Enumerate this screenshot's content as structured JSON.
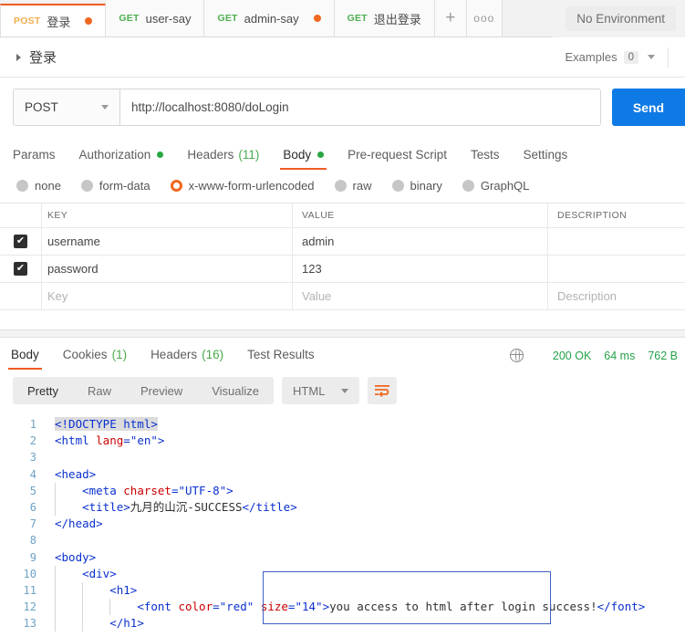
{
  "tabbar": {
    "tabs": [
      {
        "method": "POST",
        "name": "登录",
        "active": true,
        "unsaved": true
      },
      {
        "method": "GET",
        "name": "user-say",
        "active": false,
        "unsaved": false
      },
      {
        "method": "GET",
        "name": "admin-say",
        "active": false,
        "unsaved": true
      },
      {
        "method": "GET",
        "name": "退出登录",
        "active": false,
        "unsaved": false
      }
    ],
    "add_label": "+",
    "more_label": "●●●",
    "environment": "No Environment"
  },
  "request_header": {
    "title": "登录",
    "examples_label": "Examples",
    "examples_count": "0"
  },
  "url_row": {
    "method": "POST",
    "url": "http://localhost:8080/doLogin",
    "send_label": "Send"
  },
  "request_tabs": [
    {
      "label": "Params",
      "active": false,
      "dot": false,
      "count": ""
    },
    {
      "label": "Authorization",
      "active": false,
      "dot": true,
      "count": ""
    },
    {
      "label": "Headers",
      "active": false,
      "dot": false,
      "count": "(11)"
    },
    {
      "label": "Body",
      "active": true,
      "dot": true,
      "count": ""
    },
    {
      "label": "Pre-request Script",
      "active": false,
      "dot": false,
      "count": ""
    },
    {
      "label": "Tests",
      "active": false,
      "dot": false,
      "count": ""
    },
    {
      "label": "Settings",
      "active": false,
      "dot": false,
      "count": ""
    }
  ],
  "body_types": [
    {
      "label": "none",
      "selected": false
    },
    {
      "label": "form-data",
      "selected": false
    },
    {
      "label": "x-www-form-urlencoded",
      "selected": true
    },
    {
      "label": "raw",
      "selected": false
    },
    {
      "label": "binary",
      "selected": false
    },
    {
      "label": "GraphQL",
      "selected": false
    }
  ],
  "kv_table": {
    "headers": {
      "key": "KEY",
      "value": "VALUE",
      "description": "DESCRIPTION"
    },
    "rows": [
      {
        "checked": true,
        "key": "username",
        "value": "admin",
        "description": ""
      },
      {
        "checked": true,
        "key": "password",
        "value": "123",
        "description": ""
      }
    ],
    "placeholder_row": {
      "key": "Key",
      "value": "Value",
      "description": "Description"
    }
  },
  "response": {
    "tabs": [
      {
        "label": "Body",
        "active": true,
        "count": ""
      },
      {
        "label": "Cookies",
        "active": false,
        "count": "(1)"
      },
      {
        "label": "Headers",
        "active": false,
        "count": "(16)"
      },
      {
        "label": "Test Results",
        "active": false,
        "count": ""
      }
    ],
    "status": "200 OK",
    "time": "64 ms",
    "size": "762 B",
    "view_buttons": [
      {
        "label": "Pretty",
        "active": true
      },
      {
        "label": "Raw",
        "active": false
      },
      {
        "label": "Preview",
        "active": false
      },
      {
        "label": "Visualize",
        "active": false
      }
    ],
    "format": "HTML",
    "wrap_icon": "word-wrap-icon"
  },
  "code": {
    "lines": [
      {
        "n": "1",
        "html": "<span class=\"sel tag\">&lt;!DOCTYPE html&gt;</span>",
        "guides": 0
      },
      {
        "n": "2",
        "html": "<span class=\"tag\">&lt;html </span><span class=\"attr\">lang</span><span class=\"tag\">=</span><span class=\"str\">\"en\"</span><span class=\"tag\">&gt;</span>",
        "guides": 0
      },
      {
        "n": "3",
        "html": "",
        "guides": 0
      },
      {
        "n": "4",
        "html": "<span class=\"tag\">&lt;head&gt;</span>",
        "guides": 0
      },
      {
        "n": "5",
        "html": "    <span class=\"tag\">&lt;meta </span><span class=\"attr\">charset</span><span class=\"tag\">=</span><span class=\"str\">\"UTF-8\"</span><span class=\"tag\">&gt;</span>",
        "guides": 1
      },
      {
        "n": "6",
        "html": "    <span class=\"tag\">&lt;title&gt;</span><span class=\"txt\">九月的山沉-SUCCESS</span><span class=\"tag\">&lt;/title&gt;</span>",
        "guides": 1
      },
      {
        "n": "7",
        "html": "<span class=\"tag\">&lt;/head&gt;</span>",
        "guides": 0
      },
      {
        "n": "8",
        "html": "",
        "guides": 0
      },
      {
        "n": "9",
        "html": "<span class=\"tag\">&lt;body&gt;</span>",
        "guides": 0
      },
      {
        "n": "10",
        "html": "    <span class=\"tag\">&lt;div&gt;</span>",
        "guides": 1
      },
      {
        "n": "11",
        "html": "        <span class=\"tag\">&lt;h1&gt;</span>",
        "guides": 2
      },
      {
        "n": "12",
        "html": "            <span class=\"tag\">&lt;font </span><span class=\"attr\">color</span><span class=\"tag\">=</span><span class=\"str\">\"red\"</span><span class=\"tag\"> </span><span class=\"attr\">size</span><span class=\"tag\">=</span><span class=\"str\">\"14\"</span><span class=\"tag\">&gt;</span><span class=\"txt\">you access to html after login success!</span><span class=\"tag\">&lt;/font&gt;</span>",
        "guides": 3
      },
      {
        "n": "13",
        "html": "        <span class=\"tag\">&lt;/h1&gt;</span>",
        "guides": 2
      }
    ],
    "highlight_text": "<font color=\"red\" size=\"14\">you access to html after login success!</font>"
  }
}
